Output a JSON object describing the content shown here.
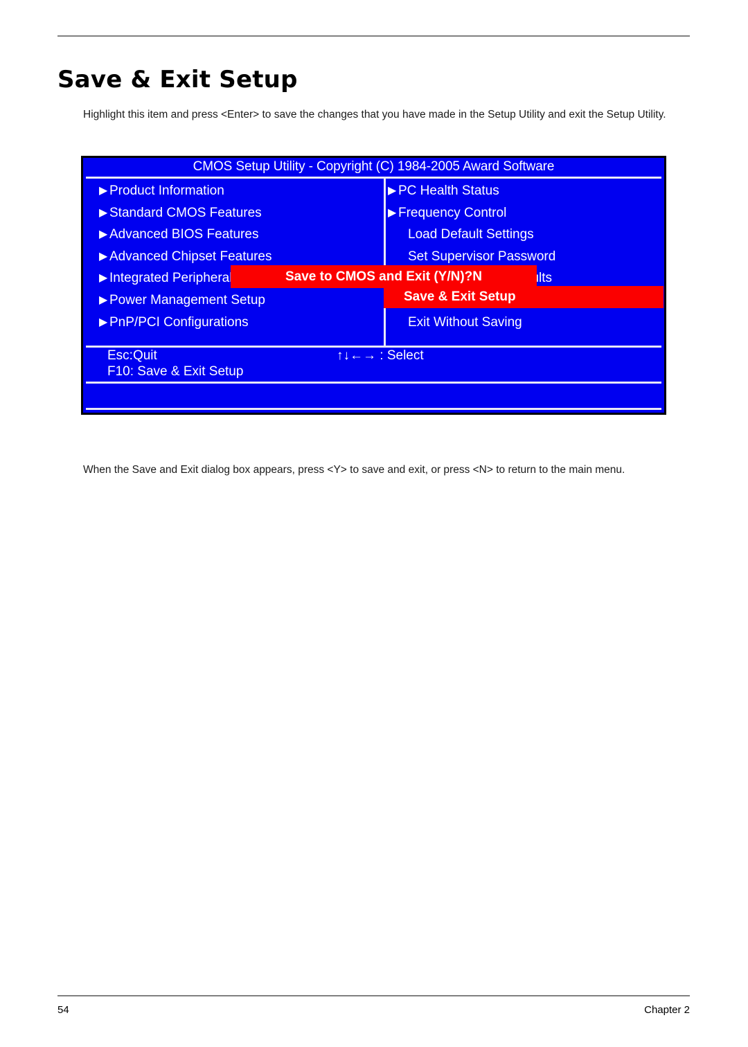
{
  "document": {
    "page_title": "Save & Exit Setup",
    "intro_paragraph": "Highlight this item and press <Enter> to save the changes that you have made in the Setup Utility and exit the Setup Utility.",
    "outro_paragraph": "When the Save and Exit dialog box appears, press <Y> to save and exit, or press <N> to return to the main menu.",
    "footer": {
      "page_number": "54",
      "chapter": "Chapter 2"
    }
  },
  "bios": {
    "title": "CMOS Setup Utility - Copyright (C) 1984-2005 Award Software",
    "colors": {
      "screen_bg": "#0000f0",
      "highlight": "#fb0000",
      "text": "#ffffff",
      "divider": "#e8e8f8",
      "border": "#000000"
    },
    "left_column": [
      {
        "marker": "▶",
        "label": "Product Information"
      },
      {
        "marker": "▶",
        "label": "Standard CMOS Features"
      },
      {
        "marker": "▶",
        "label": "Advanced BIOS Features"
      },
      {
        "marker": "▶",
        "label": "Advanced Chipset Features"
      },
      {
        "marker": "▶",
        "label": "Integrated Peripherals"
      },
      {
        "marker": "▶",
        "label": "Power Management Setup"
      },
      {
        "marker": "▶",
        "label": "PnP/PCI Configurations"
      }
    ],
    "right_column": [
      {
        "marker": "▶",
        "label": "PC Health Status"
      },
      {
        "marker": "▶",
        "label": "Frequency Control"
      },
      {
        "marker": "",
        "label": "Load Default Settings"
      },
      {
        "marker": "",
        "label": "Set Supervisor Password"
      },
      {
        "marker": "",
        "label": "Load Optimized Defaults"
      },
      {
        "marker": "",
        "label": "Save & Exit Setup"
      },
      {
        "marker": "",
        "label": "Exit Without Saving"
      }
    ],
    "selected_item": "Save & Exit Setup",
    "dialog": {
      "prompt": "Save to CMOS and Exit (Y/N)?N"
    },
    "keys": {
      "quit": "Esc:Quit",
      "select": "↑↓←→ : Select",
      "save_exit": "F10: Save & Exit Setup"
    }
  }
}
